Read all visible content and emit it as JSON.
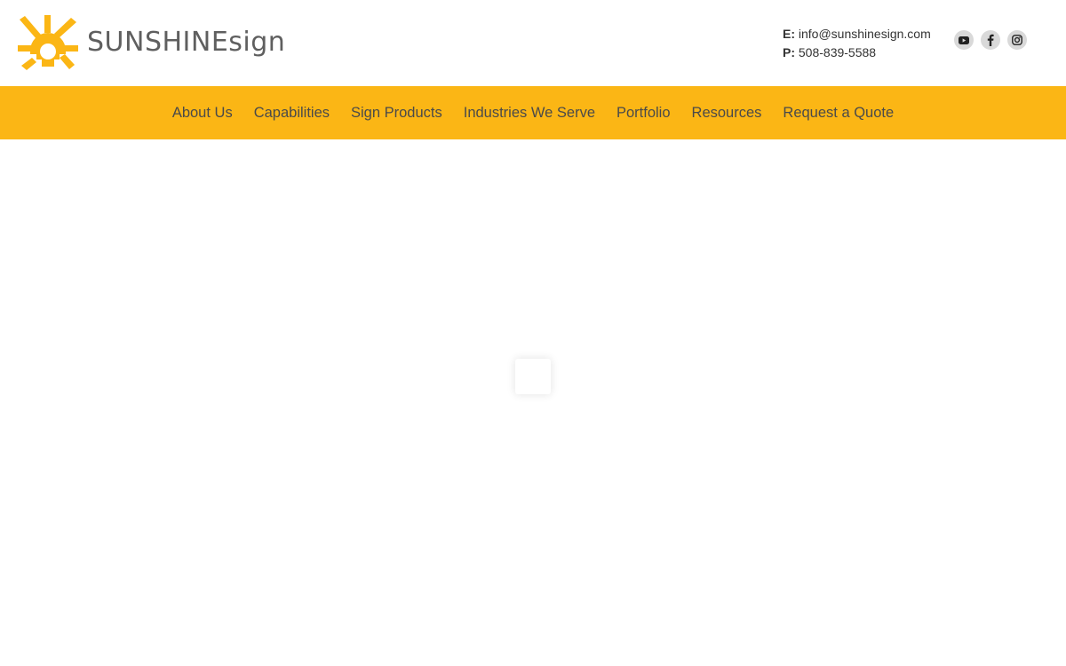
{
  "brand": {
    "name_main": "SUNSHINE",
    "name_suffix": "sign",
    "accent_color": "#fbb615",
    "text_color": "#5f5f5f"
  },
  "contact": {
    "email_label": "E:",
    "email": "info@sunshinesign.com",
    "phone_label": "P:",
    "phone": "508-839-5588"
  },
  "social": [
    {
      "name": "youtube-icon"
    },
    {
      "name": "facebook-icon"
    },
    {
      "name": "instagram-icon"
    }
  ],
  "nav": {
    "items": [
      {
        "label": "About Us"
      },
      {
        "label": "Capabilities"
      },
      {
        "label": "Sign Products"
      },
      {
        "label": "Industries We Serve"
      },
      {
        "label": "Portfolio"
      },
      {
        "label": "Resources"
      },
      {
        "label": "Request a Quote"
      }
    ]
  }
}
